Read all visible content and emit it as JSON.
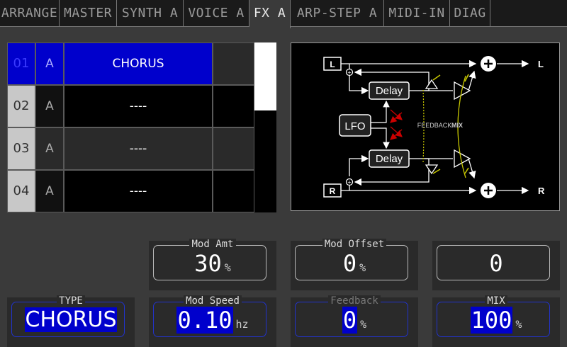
{
  "tabs": [
    {
      "label": "ARRANGE",
      "active": false
    },
    {
      "label": "MASTER",
      "active": false
    },
    {
      "label": "SYNTH A",
      "active": false
    },
    {
      "label": "VOICE A",
      "active": false
    },
    {
      "label": "FX A",
      "active": true
    },
    {
      "label": "ARP-STEP A",
      "active": false
    },
    {
      "label": "MIDI-IN",
      "active": false
    },
    {
      "label": "DIAG",
      "active": false
    }
  ],
  "slots": [
    {
      "num": "01",
      "bank": "A",
      "name": "CHORUS",
      "selected": true
    },
    {
      "num": "02",
      "bank": "A",
      "name": "----",
      "selected": false
    },
    {
      "num": "03",
      "bank": "A",
      "name": "----",
      "selected": false
    },
    {
      "num": "04",
      "bank": "A",
      "name": "----",
      "selected": false
    }
  ],
  "diagram": {
    "input_l": "L",
    "input_r": "R",
    "output_l": "L",
    "output_r": "R",
    "delay_top": "Delay",
    "delay_bottom": "Delay",
    "lfo": "LFO",
    "feedback": "FEEDBACK",
    "mix": "MIX"
  },
  "params": {
    "mod_amt": {
      "label": "Mod Amt",
      "value": "30",
      "unit": "%"
    },
    "mod_offset": {
      "label": "Mod Offset",
      "value": "0",
      "unit": "%"
    },
    "extra": {
      "label": "",
      "value": "0",
      "unit": ""
    },
    "type": {
      "label": "TYPE",
      "value": "CHORUS"
    },
    "mod_speed": {
      "label": "Mod Speed",
      "value": "0.10",
      "unit": "hz"
    },
    "feedback": {
      "label": "Feedback",
      "value": "0",
      "unit": "%"
    },
    "mix": {
      "label": "MIX",
      "value": "100",
      "unit": "%"
    }
  },
  "colors": {
    "accent": "#0000cc",
    "background": "#3a3a3a",
    "diagram_line": "#c8c800",
    "lfo_arrow": "#cc0000"
  }
}
